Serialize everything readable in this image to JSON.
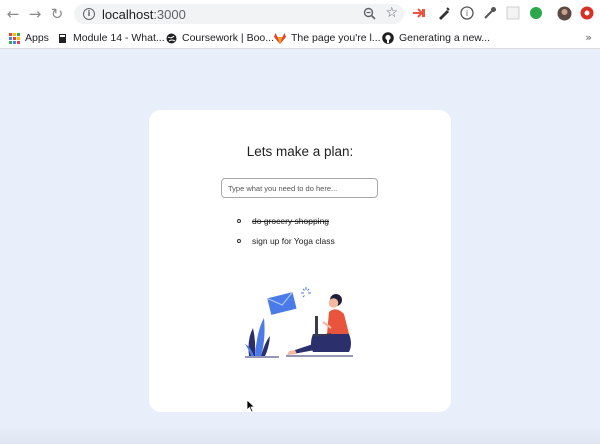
{
  "browser": {
    "url_host": "localhost",
    "url_port": ":3000",
    "info_glyph": "i",
    "bookmarks": [
      {
        "label": "Apps",
        "icon": "apps-grid-icon"
      },
      {
        "label": "Module 14 - What...",
        "icon": "book-icon"
      },
      {
        "label": "Coursework | Boo...",
        "icon": "globe-icon"
      },
      {
        "label": "The page you're l...",
        "icon": "gitlab-icon"
      },
      {
        "label": "Generating a new...",
        "icon": "github-icon"
      }
    ],
    "more_bookmarks": "»"
  },
  "app": {
    "heading": "Lets make a plan:",
    "input_placeholder": "Type what you need to do here...",
    "input_value": "",
    "todos": [
      {
        "text": "do grocery shopping",
        "completed": true
      },
      {
        "text": "sign up for Yoga class",
        "completed": false
      }
    ]
  },
  "colors": {
    "page_background": "#e9effa",
    "card_background": "#ffffff",
    "illustration_blue": "#4a7be8",
    "illustration_orange": "#e8553c",
    "illustration_navy": "#2b2f6b"
  }
}
